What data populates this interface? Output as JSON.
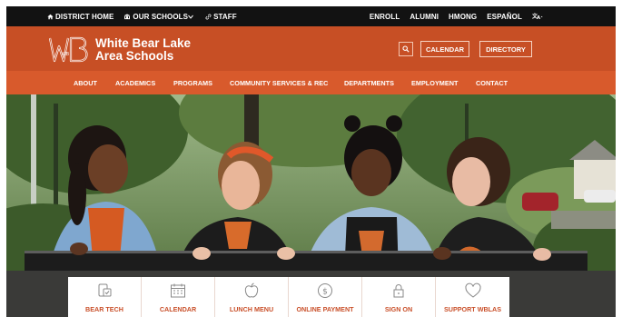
{
  "topbar": {
    "left": [
      {
        "label": "DISTRICT HOME",
        "icon": "home-icon"
      },
      {
        "label": "OUR SCHOOLS",
        "icon": "school-icon"
      },
      {
        "label": "STAFF",
        "icon": "link-icon"
      }
    ],
    "right": [
      "ENROLL",
      "ALUMNI",
      "HMONG",
      "ESPAÑOL"
    ],
    "translate_icon": "translate-icon"
  },
  "header": {
    "logo_text": "WB",
    "school_name_line1": "White Bear Lake",
    "school_name_line2": "Area Schools",
    "calendar_label": "CALENDAR",
    "directory_label": "DIRECTORY"
  },
  "nav": [
    "ABOUT",
    "ACADEMICS",
    "PROGRAMS",
    "COMMUNITY SERVICES & REC",
    "DEPARTMENTS",
    "EMPLOYMENT",
    "CONTACT"
  ],
  "quicklinks": [
    {
      "label": "BEAR TECH",
      "icon": "device-icon"
    },
    {
      "label": "CALENDAR",
      "icon": "calendar-icon"
    },
    {
      "label": "LUNCH MENU",
      "icon": "apple-icon"
    },
    {
      "label": "ONLINE PAYMENT",
      "icon": "dollar-icon"
    },
    {
      "label": "SIGN ON",
      "icon": "lock-icon"
    },
    {
      "label": "SUPPORT WBLAS",
      "icon": "heart-icon"
    }
  ],
  "colors": {
    "topbar": "#121212",
    "header": "#c74f25",
    "nav": "#d85a2c",
    "accent": "#c9502a"
  }
}
